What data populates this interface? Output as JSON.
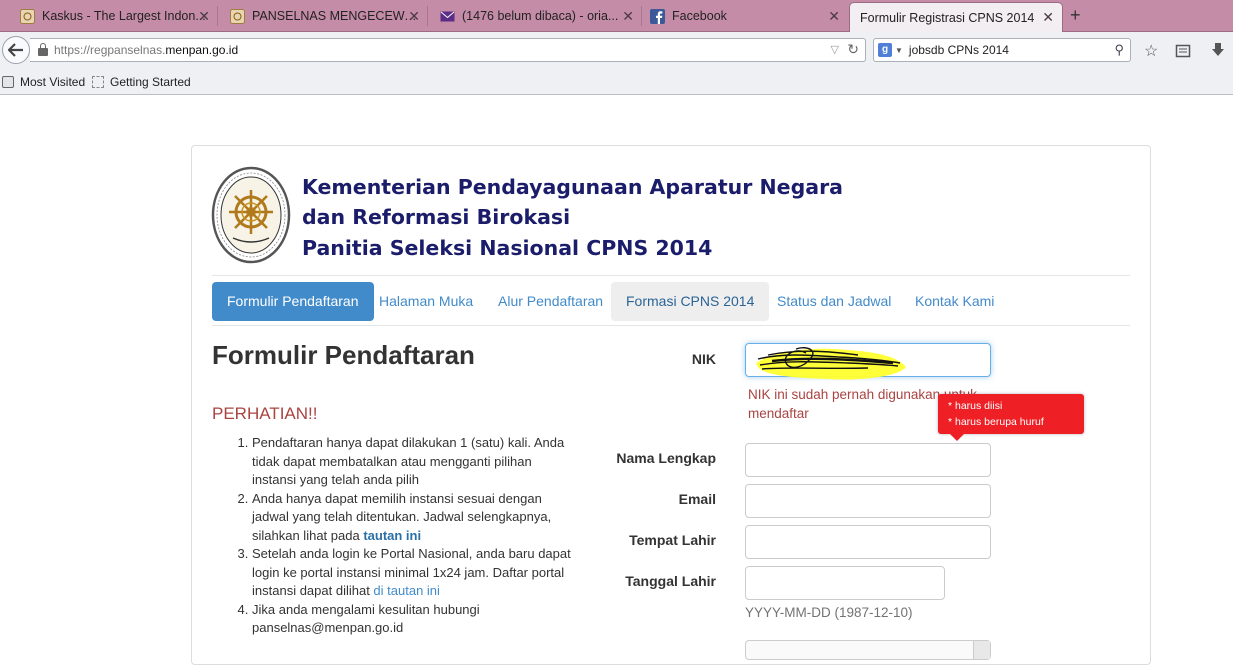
{
  "browser": {
    "tabs": [
      {
        "title": "Kaskus - The Largest Indon...",
        "icon": "kaskus-icon"
      },
      {
        "title": "PANSELNAS MENGECEWA...",
        "icon": "kaskus-icon"
      },
      {
        "title": "(1476 belum dibaca) - oria...",
        "icon": "yahoo-mail-icon"
      },
      {
        "title": "Facebook",
        "icon": "facebook-icon"
      },
      {
        "title": "Formulir Registrasi CPNS 2014",
        "icon": null
      }
    ],
    "new_tab": "+",
    "url_prefix": "https://regpanselnas.",
    "url_domain": "menpan.go.id",
    "search_value": "jobsdb CPNs 2014",
    "bookmarks": [
      "Most Visited",
      "Getting Started"
    ]
  },
  "header": {
    "line1": "Kementerian Pendayagunaan Aparatur Negara",
    "line2": "dan Reformasi Birokasi",
    "line3": "Panitia Seleksi Nasional CPNS 2014"
  },
  "nav": [
    "Formulir Pendaftaran",
    "Halaman Muka",
    "Alur Pendaftaran",
    "Formasi CPNS 2014",
    "Status dan Jadwal",
    "Kontak Kami"
  ],
  "page": {
    "title": "Formulir Pendaftaran",
    "attention": "PERHATIAN!!",
    "notes": {
      "n1": "Pendaftaran hanya dapat dilakukan 1 (satu) kali. Anda tidak dapat membatalkan atau mengganti pilihan instansi yang telah anda pilih",
      "n2_text": "Anda hanya dapat memilih instansi sesuai dengan jadwal yang telah ditentukan. Jadwal selengkapnya, silahkan lihat pada ",
      "n2_link": "tautan ini",
      "n3_text": "Setelah anda login ke Portal Nasional, anda baru dapat login ke portal instansi minimal 1x24 jam. Daftar portal instansi dapat dilihat ",
      "n3_link": "di tautan ini",
      "n4": "Jika anda mengalami kesulitan hubungi panselnas@menpan.go.id"
    }
  },
  "form": {
    "nik_label": "NIK",
    "nik_error": "NIK ini sudah pernah digunakan untuk mendaftar",
    "tooltip_1": "* harus diisi",
    "tooltip_2": "* harus berupa huruf",
    "nama_label": "Nama Lengkap",
    "email_label": "Email",
    "tempat_label": "Tempat Lahir",
    "tanggal_label": "Tanggal Lahir",
    "tanggal_help": "YYYY-MM-DD (1987-12-10)"
  },
  "colors": {
    "accent": "#428bca",
    "heading": "#1b1d6b",
    "error": "#a94442",
    "tooltip": "#ee1f25",
    "tabbar": "#c58ca8"
  }
}
